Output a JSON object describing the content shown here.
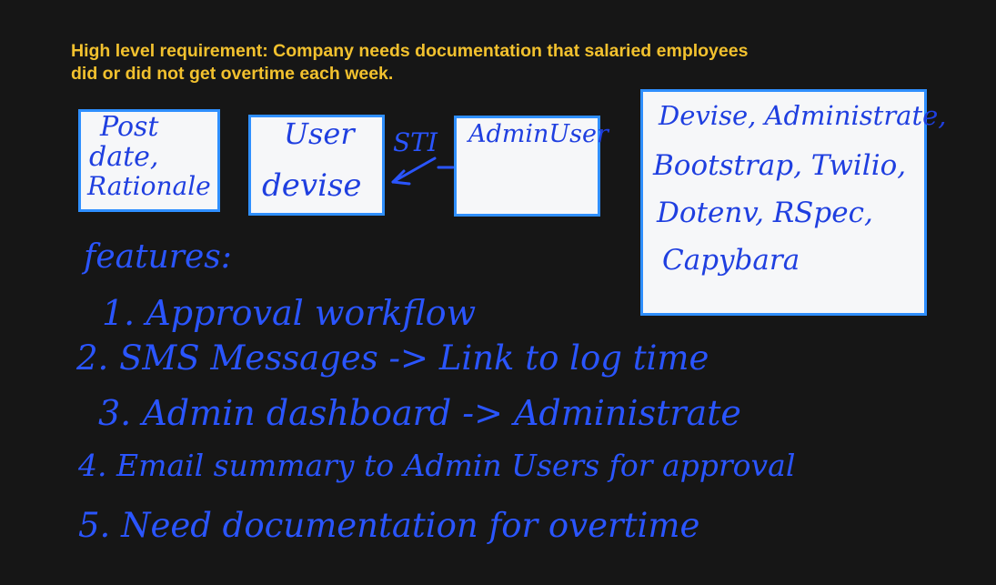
{
  "header": {
    "line1": "High level requirement: Company needs documentation that salaried employees",
    "line2": "did or did not get overtime each week."
  },
  "diagram": {
    "box_post": {
      "line1": "Post",
      "line2": "date,",
      "line3": "Rationale"
    },
    "box_user": {
      "line1": "User",
      "line2": "devise"
    },
    "sti_label": "STI",
    "box_admin": {
      "line1": "AdminUser"
    },
    "box_tools": {
      "line1": "Devise, Administrate,",
      "line2": "Bootstrap, Twilio,",
      "line3": "Dotenv, RSpec,",
      "line4": "Capybara"
    }
  },
  "features": {
    "title": "features:",
    "items": [
      "1. Approval workflow",
      "2. SMS Messages -> Link to log time",
      "3. Admin dashboard -> Administrate",
      "4. Email summary to Admin Users for approval",
      "5. Need documentation for overtime"
    ]
  },
  "colors": {
    "background": "#161616",
    "heading": "#f2c12e",
    "box_border": "#2f8fff",
    "box_fill": "#f6f7f9",
    "ink_in_box": "#1f3fe0",
    "ink_on_dark": "#2a55ff"
  }
}
